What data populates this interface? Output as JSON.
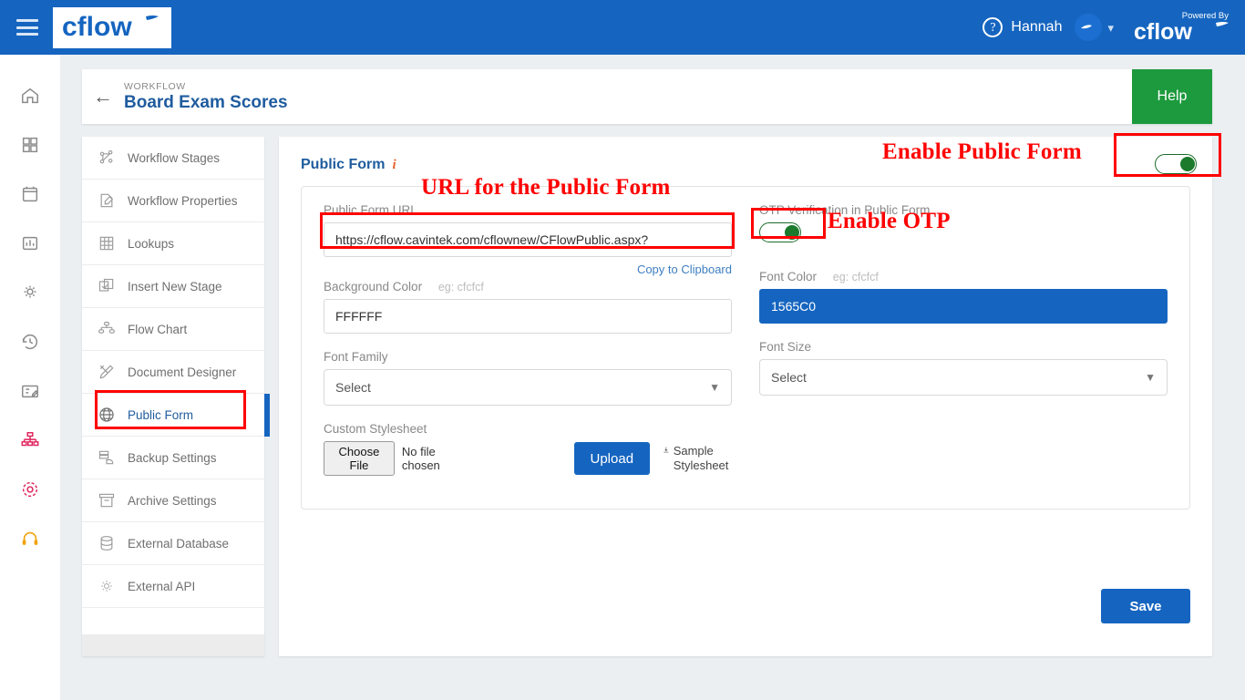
{
  "header": {
    "menu_icon": "hamburger-icon",
    "logo_text": "cflow",
    "help_icon": "help-circle-icon",
    "user_name": "Hannah",
    "avatar_icon": "avatar-icon",
    "chevron_icon": "chevron-down-icon",
    "powered_by_label": "Powered By",
    "powered_by_logo": "cflow",
    "bar_color": "#1565C0"
  },
  "rail": {
    "items": [
      {
        "icon": "home-icon",
        "color": "#8a8a8a"
      },
      {
        "icon": "grid-apps-icon",
        "color": "#8a8a8a"
      },
      {
        "icon": "calendar-icon",
        "color": "#8a8a8a"
      },
      {
        "icon": "bar-chart-icon",
        "color": "#8a8a8a"
      },
      {
        "icon": "gear-settings-icon",
        "color": "#8a8a8a"
      },
      {
        "icon": "history-clock-icon",
        "color": "#8a8a8a"
      },
      {
        "icon": "report-edit-icon",
        "color": "#8a8a8a"
      },
      {
        "icon": "org-chart-icon",
        "color": "#e0245e"
      },
      {
        "icon": "target-icon",
        "color": "#e0245e"
      },
      {
        "icon": "headset-support-icon",
        "color": "#f0a30a"
      }
    ]
  },
  "workflow": {
    "back_icon": "back-arrow-icon",
    "kicker": "WORKFLOW",
    "title": "Board Exam Scores",
    "help_label": "Help",
    "help_color": "#1d9a3d"
  },
  "nav": {
    "items": [
      {
        "label": "Workflow Stages",
        "icon": "workflow-stages-icon",
        "active": false
      },
      {
        "label": "Workflow Properties",
        "icon": "workflow-properties-icon",
        "active": false
      },
      {
        "label": "Lookups",
        "icon": "lookups-grid-icon",
        "active": false
      },
      {
        "label": "Insert New Stage",
        "icon": "insert-new-stage-icon",
        "active": false
      },
      {
        "label": "Flow Chart",
        "icon": "flow-chart-icon",
        "active": false
      },
      {
        "label": "Document Designer",
        "icon": "document-designer-icon",
        "active": false
      },
      {
        "label": "Public Form",
        "icon": "globe-icon",
        "active": true
      },
      {
        "label": "Backup Settings",
        "icon": "backup-settings-icon",
        "active": false
      },
      {
        "label": "Archive Settings",
        "icon": "archive-settings-icon",
        "active": false
      },
      {
        "label": "External Database",
        "icon": "database-icon",
        "active": false
      },
      {
        "label": "External API",
        "icon": "api-gear-icon",
        "active": false
      }
    ]
  },
  "panel": {
    "title": "Public Form",
    "info_icon": "info-icon",
    "public_form_url": {
      "label": "Public Form URL",
      "value": "https://cflow.cavintek.com/cflownew/CFlowPublic.aspx?"
    },
    "copy_to_clipboard": "Copy to Clipboard",
    "otp": {
      "label": "OTP Verification in Public Form",
      "enabled": true
    },
    "enable_public_form": {
      "enabled": true
    },
    "background_color": {
      "label": "Background Color",
      "hint": "eg: cfcfcf",
      "value": "FFFFFF"
    },
    "font_color": {
      "label": "Font Color",
      "hint": "eg: cfcfcf",
      "value": "1565C0",
      "swatch": "#1565C0"
    },
    "font_family": {
      "label": "Font Family",
      "value": "Select"
    },
    "font_size": {
      "label": "Font Size",
      "value": "Select"
    },
    "custom_stylesheet": {
      "label": "Custom Stylesheet",
      "choose_file_label": "Choose File",
      "no_file_label": "No file chosen",
      "upload_label": "Upload",
      "sample_label": "Sample Stylesheet",
      "download_icon": "download-icon"
    },
    "save_label": "Save"
  },
  "annotations": {
    "color": "#ff0000",
    "labels": [
      {
        "text": "Enable Public Form"
      },
      {
        "text": "URL for the Public Form"
      },
      {
        "text": "Enable OTP"
      }
    ]
  }
}
